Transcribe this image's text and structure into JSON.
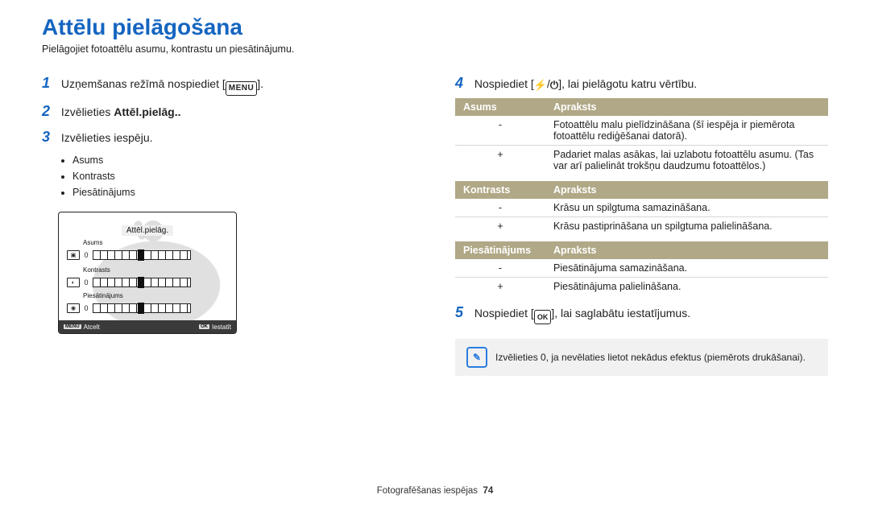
{
  "title": "Attēlu pielāgošana",
  "subtitle": "Pielāgojiet fotoattēlu asumu, kontrastu un piesātinājumu.",
  "left": {
    "step1": {
      "num": "1",
      "text_a": "Uzņemšanas režīmā nospiediet [",
      "text_b": "]."
    },
    "step2": {
      "num": "2",
      "text_a": "Izvēlieties ",
      "bold": "Attēl.pielāg.."
    },
    "step3": {
      "num": "3",
      "text": "Izvēlieties iespēju."
    },
    "bullets": [
      "Asums",
      "Kontrasts",
      "Piesātinājums"
    ],
    "camera": {
      "title": "Attēl.pielāg.",
      "rows": [
        {
          "label": "Asums",
          "val": "0"
        },
        {
          "label": "Kontrasts",
          "val": "0"
        },
        {
          "label": "Piesātinājums",
          "val": "0"
        }
      ],
      "footer_left": "Atcelt",
      "footer_right": "Iestatīt"
    }
  },
  "right": {
    "step4": {
      "num": "4",
      "text_a": "Nospiediet [",
      "text_mid": "/",
      "text_b": "], lai pielāgotu katru vērtību."
    },
    "step5": {
      "num": "5",
      "text_a": "Nospiediet [",
      "text_b": "], lai saglabātu iestatījumus."
    },
    "tables": [
      {
        "head": [
          "Asums",
          "Apraksts"
        ],
        "rows": [
          [
            "-",
            "Fotoattēlu malu pielīdzināšana (šī iespēja ir piemērota fotoattēlu rediģēšanai datorā)."
          ],
          [
            "+",
            "Padariet malas asākas, lai uzlabotu fotoattēlu asumu. (Tas var arī palielināt trokšņu daudzumu fotoattēlos.)"
          ]
        ]
      },
      {
        "head": [
          "Kontrasts",
          "Apraksts"
        ],
        "rows": [
          [
            "-",
            "Krāsu un spilgtuma samazināšana."
          ],
          [
            "+",
            "Krāsu pastiprināšana un spilgtuma palielināšana."
          ]
        ]
      },
      {
        "head": [
          "Piesātinājums",
          "Apraksts"
        ],
        "rows": [
          [
            "-",
            "Piesātinājuma samazināšana."
          ],
          [
            "+",
            "Piesātinājuma palielināšana."
          ]
        ]
      }
    ],
    "note": "Izvēlieties 0, ja nevēlaties lietot nekādus efektus (piemērots drukāšanai)."
  },
  "footer": {
    "section": "Fotografēšanas iespējas",
    "page": "74"
  },
  "icons": {
    "menu": "MENU",
    "ok": "OK",
    "flash": "⚡",
    "timer": "⏻",
    "note": "✎"
  }
}
